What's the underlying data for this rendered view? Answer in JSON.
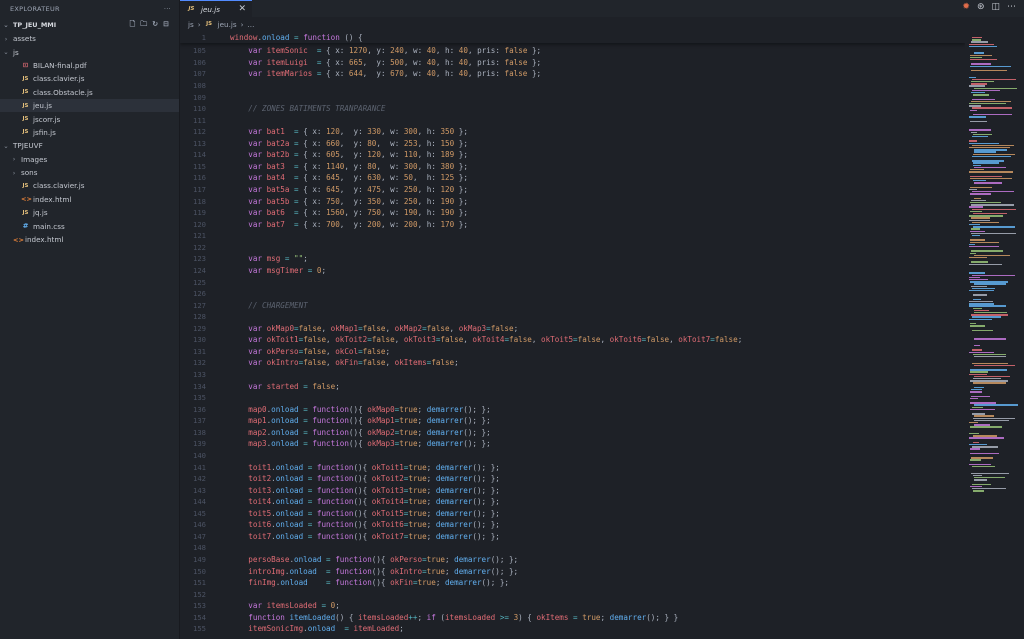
{
  "sidebar": {
    "title": "EXPLORATEUR",
    "more": "···",
    "workspace": "TP_JEU_MMI",
    "items": [
      {
        "label": "assets",
        "type": "folder",
        "depth": 1,
        "open": false
      },
      {
        "label": "js",
        "type": "folder",
        "depth": 1,
        "open": true
      },
      {
        "label": "BILAN-final.pdf",
        "type": "pdf",
        "depth": 2
      },
      {
        "label": "class.clavier.js",
        "type": "js",
        "depth": 2
      },
      {
        "label": "class.Obstacle.js",
        "type": "js",
        "depth": 2
      },
      {
        "label": "jeu.js",
        "type": "js",
        "depth": 2,
        "selected": true
      },
      {
        "label": "jscorr.js",
        "type": "js",
        "depth": 2
      },
      {
        "label": "jsfin.js",
        "type": "js",
        "depth": 2
      },
      {
        "label": "TPJEUVF",
        "type": "folder",
        "depth": 1,
        "open": true
      },
      {
        "label": "Images",
        "type": "folder",
        "depth": 2,
        "open": false
      },
      {
        "label": "sons",
        "type": "folder",
        "depth": 2,
        "open": false
      },
      {
        "label": "class.clavier.js",
        "type": "js",
        "depth": 2
      },
      {
        "label": "index.html",
        "type": "html",
        "depth": 2
      },
      {
        "label": "jq.js",
        "type": "js",
        "depth": 2
      },
      {
        "label": "main.css",
        "type": "css",
        "depth": 2
      },
      {
        "label": "index.html",
        "type": "html",
        "depth": 1
      }
    ]
  },
  "tabs": [
    {
      "icon": "JS",
      "label": "jeu.js",
      "close": "✕"
    }
  ],
  "breadcrumb": {
    "folder": "js",
    "sep": "›",
    "icon": "JS",
    "file": "jeu.js",
    "rest": "..."
  },
  "sticky": {
    "ln": "1",
    "code": "window.onload = function () {"
  },
  "colors": {
    "editor_bg": "#1e2127",
    "sidebar_bg": "#21252b",
    "keyword": "#c678dd",
    "variable": "#e06c75",
    "number": "#d19a66",
    "function": "#61afef",
    "comment": "#5c6370"
  },
  "code_lines": [
    {
      "ln": "105",
      "code": "    var itemSonic  = { x: 1270, y: 240, w: 40, h: 40, pris: false };"
    },
    {
      "ln": "106",
      "code": "    var itemLuigi  = { x: 665,  y: 500, w: 40, h: 40, pris: false };"
    },
    {
      "ln": "107",
      "code": "    var itemMarios = { x: 644,  y: 670, w: 40, h: 40, pris: false };"
    },
    {
      "ln": "108",
      "code": ""
    },
    {
      "ln": "109",
      "code": ""
    },
    {
      "ln": "110",
      "code": "    // ZONES BATIMENTS TRANPARANCE"
    },
    {
      "ln": "111",
      "code": ""
    },
    {
      "ln": "112",
      "code": "    var bat1  = { x: 120,  y: 330, w: 300, h: 350 };"
    },
    {
      "ln": "113",
      "code": "    var bat2a = { x: 660,  y: 80,  w: 253, h: 150 };"
    },
    {
      "ln": "114",
      "code": "    var bat2b = { x: 605,  y: 120, w: 110, h: 189 };"
    },
    {
      "ln": "115",
      "code": "    var bat3  = { x: 1140, y: 80,  w: 300, h: 380 };"
    },
    {
      "ln": "116",
      "code": "    var bat4  = { x: 645,  y: 630, w: 50,  h: 125 };"
    },
    {
      "ln": "117",
      "code": "    var bat5a = { x: 645,  y: 475, w: 250, h: 120 };"
    },
    {
      "ln": "118",
      "code": "    var bat5b = { x: 750,  y: 350, w: 250, h: 190 };"
    },
    {
      "ln": "119",
      "code": "    var bat6  = { x: 1560, y: 750, w: 190, h: 190 };"
    },
    {
      "ln": "120",
      "code": "    var bat7  = { x: 700,  y: 200, w: 200, h: 170 };"
    },
    {
      "ln": "121",
      "code": ""
    },
    {
      "ln": "122",
      "code": ""
    },
    {
      "ln": "123",
      "code": "    var msg = \"\";"
    },
    {
      "ln": "124",
      "code": "    var msgTimer = 0;"
    },
    {
      "ln": "125",
      "code": ""
    },
    {
      "ln": "126",
      "code": ""
    },
    {
      "ln": "127",
      "code": "    // CHARGEMENT"
    },
    {
      "ln": "128",
      "code": ""
    },
    {
      "ln": "129",
      "code": "    var okMap0=false, okMap1=false, okMap2=false, okMap3=false;"
    },
    {
      "ln": "130",
      "code": "    var okToit1=false, okToit2=false, okToit3=false, okToit4=false, okToit5=false, okToit6=false, okToit7=false;"
    },
    {
      "ln": "131",
      "code": "    var okPerso=false, okCol=false;"
    },
    {
      "ln": "132",
      "code": "    var okIntro=false, okFin=false, okItems=false;"
    },
    {
      "ln": "133",
      "code": ""
    },
    {
      "ln": "134",
      "code": "    var started = false;"
    },
    {
      "ln": "135",
      "code": ""
    },
    {
      "ln": "136",
      "code": "    map0.onload = function(){ okMap0=true; demarrer(); };"
    },
    {
      "ln": "137",
      "code": "    map1.onload = function(){ okMap1=true; demarrer(); };"
    },
    {
      "ln": "138",
      "code": "    map2.onload = function(){ okMap2=true; demarrer(); };"
    },
    {
      "ln": "139",
      "code": "    map3.onload = function(){ okMap3=true; demarrer(); };"
    },
    {
      "ln": "140",
      "code": ""
    },
    {
      "ln": "141",
      "code": "    toit1.onload = function(){ okToit1=true; demarrer(); };"
    },
    {
      "ln": "142",
      "code": "    toit2.onload = function(){ okToit2=true; demarrer(); };"
    },
    {
      "ln": "143",
      "code": "    toit3.onload = function(){ okToit3=true; demarrer(); };"
    },
    {
      "ln": "144",
      "code": "    toit4.onload = function(){ okToit4=true; demarrer(); };"
    },
    {
      "ln": "145",
      "code": "    toit5.onload = function(){ okToit5=true; demarrer(); };"
    },
    {
      "ln": "146",
      "code": "    toit6.onload = function(){ okToit6=true; demarrer(); };"
    },
    {
      "ln": "147",
      "code": "    toit7.onload = function(){ okToit7=true; demarrer(); };"
    },
    {
      "ln": "148",
      "code": ""
    },
    {
      "ln": "149",
      "code": "    persoBase.onload = function(){ okPerso=true; demarrer(); };"
    },
    {
      "ln": "150",
      "code": "    introImg.onload  = function(){ okIntro=true; demarrer(); };"
    },
    {
      "ln": "151",
      "code": "    finImg.onload    = function(){ okFin=true; demarrer(); };"
    },
    {
      "ln": "152",
      "code": ""
    },
    {
      "ln": "153",
      "code": "    var itemsLoaded = 0;"
    },
    {
      "ln": "154",
      "code": "    function itemLoaded() { itemsLoaded++; if (itemsLoaded >= 3) { okItems = true; demarrer(); } }"
    },
    {
      "ln": "155",
      "code": "    itemSonicImg.onload  = itemLoaded;"
    }
  ]
}
